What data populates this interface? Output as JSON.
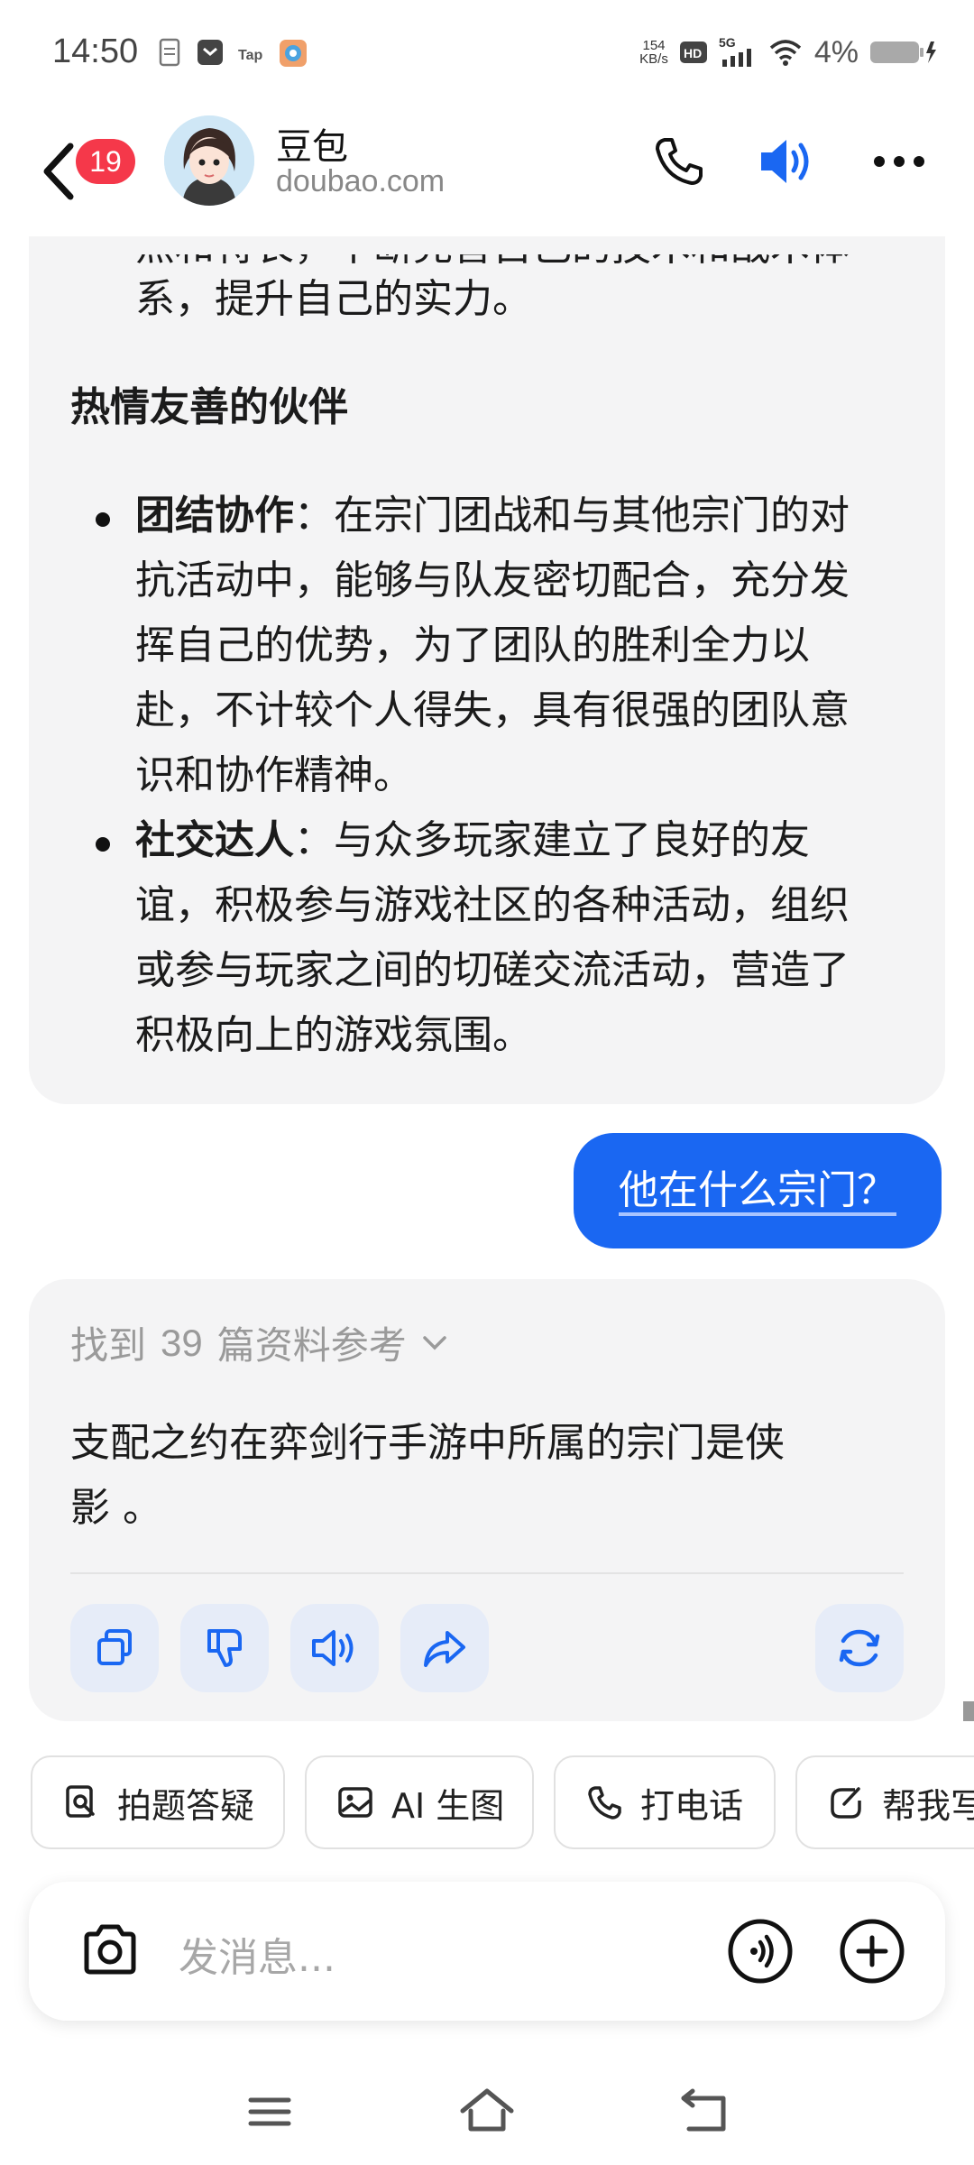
{
  "status_bar": {
    "time": "14:50",
    "net_speed_value": "154",
    "net_speed_unit": "KB/s",
    "network_type": "5G",
    "battery_percent": "4%"
  },
  "header": {
    "unread_count": "19",
    "title": "豆包",
    "subtitle": "doubao.com"
  },
  "message1": {
    "partial_line": "点和特长，不断完善自己的技术和战术体",
    "line_cont": "系，提升自己的实力。",
    "heading": "热情友善的伙伴",
    "item1_title": "团结协作",
    "item1_line1": "：在宗门团战和与其他宗门的对",
    "item1_line2": "抗活动中，能够与队友密切配合，充分发",
    "item1_line3": "挥自己的优势，为了团队的胜利全力以",
    "item1_line4": "赴，不计较个人得失，具有很强的团队意",
    "item1_line5": "识和协作精神。",
    "item2_title": "社交达人",
    "item2_line1": "：与众多玩家建立了良好的友",
    "item2_line2": "谊，积极参与游戏社区的各种活动，组织",
    "item2_line3": "或参与玩家之间的切磋交流活动，营造了",
    "item2_line4": "积极向上的游戏氛围。"
  },
  "user_message": "他在什么宗门？",
  "message2": {
    "refs_prefix": "找到",
    "refs_count": "39",
    "refs_suffix": "篇资料参考",
    "answer_line1": "支配之约在弈剑行手游中所属的宗门是侠",
    "answer_line2": "影 。"
  },
  "quick_actions": [
    "拍题答疑",
    "AI 生图",
    "打电话",
    "帮我写"
  ],
  "input": {
    "placeholder": "发消息..."
  },
  "colors": {
    "accent": "#1a67f2",
    "badge": "#f5384a",
    "bubble_bg": "#f4f4f5",
    "action_bg": "#e6ecf8"
  }
}
